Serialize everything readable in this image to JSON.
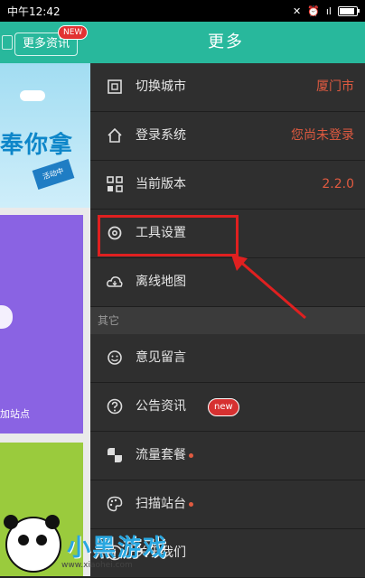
{
  "status_bar": {
    "time": "中午12:42",
    "signal": "ıl",
    "battery_level": 0.8
  },
  "header": {
    "title": "更多",
    "more_news_label": "更多资讯",
    "new_badge": "NEW"
  },
  "left_cards": {
    "blue_card_text": "奉你拿",
    "ribbon_text": "活动中",
    "purple_card_text": "加站点"
  },
  "menu": {
    "items_top": [
      {
        "label": "切换城市",
        "value": "厦门市",
        "icon": "switch-icon"
      },
      {
        "label": "登录系统",
        "value": "您尚未登录",
        "icon": "home-icon"
      },
      {
        "label": "当前版本",
        "value": "2.2.0",
        "icon": "grid-icon"
      },
      {
        "label": "工具设置",
        "value": "",
        "icon": "gear-icon"
      },
      {
        "label": "离线地图",
        "value": "",
        "icon": "cloud-download-icon"
      }
    ],
    "section_other": "其它",
    "items_other": [
      {
        "label": "意见留言",
        "icon": "smiley-icon"
      },
      {
        "label": "公告资讯",
        "icon": "question-icon",
        "badge": "new"
      },
      {
        "label": "流量套餐",
        "icon": "pie-icon",
        "dot": true
      },
      {
        "label": "扫描站台",
        "icon": "palette-icon",
        "dot": true
      },
      {
        "label": "关于我们",
        "icon": "info-icon"
      }
    ]
  },
  "watermark": {
    "brand": "小黑游戏",
    "url": "www.xiaohei.com"
  },
  "colors": {
    "header": "#28b89c",
    "drawer": "#2e2e2e",
    "accent_value": "#e05a40",
    "highlight": "#e02020"
  }
}
